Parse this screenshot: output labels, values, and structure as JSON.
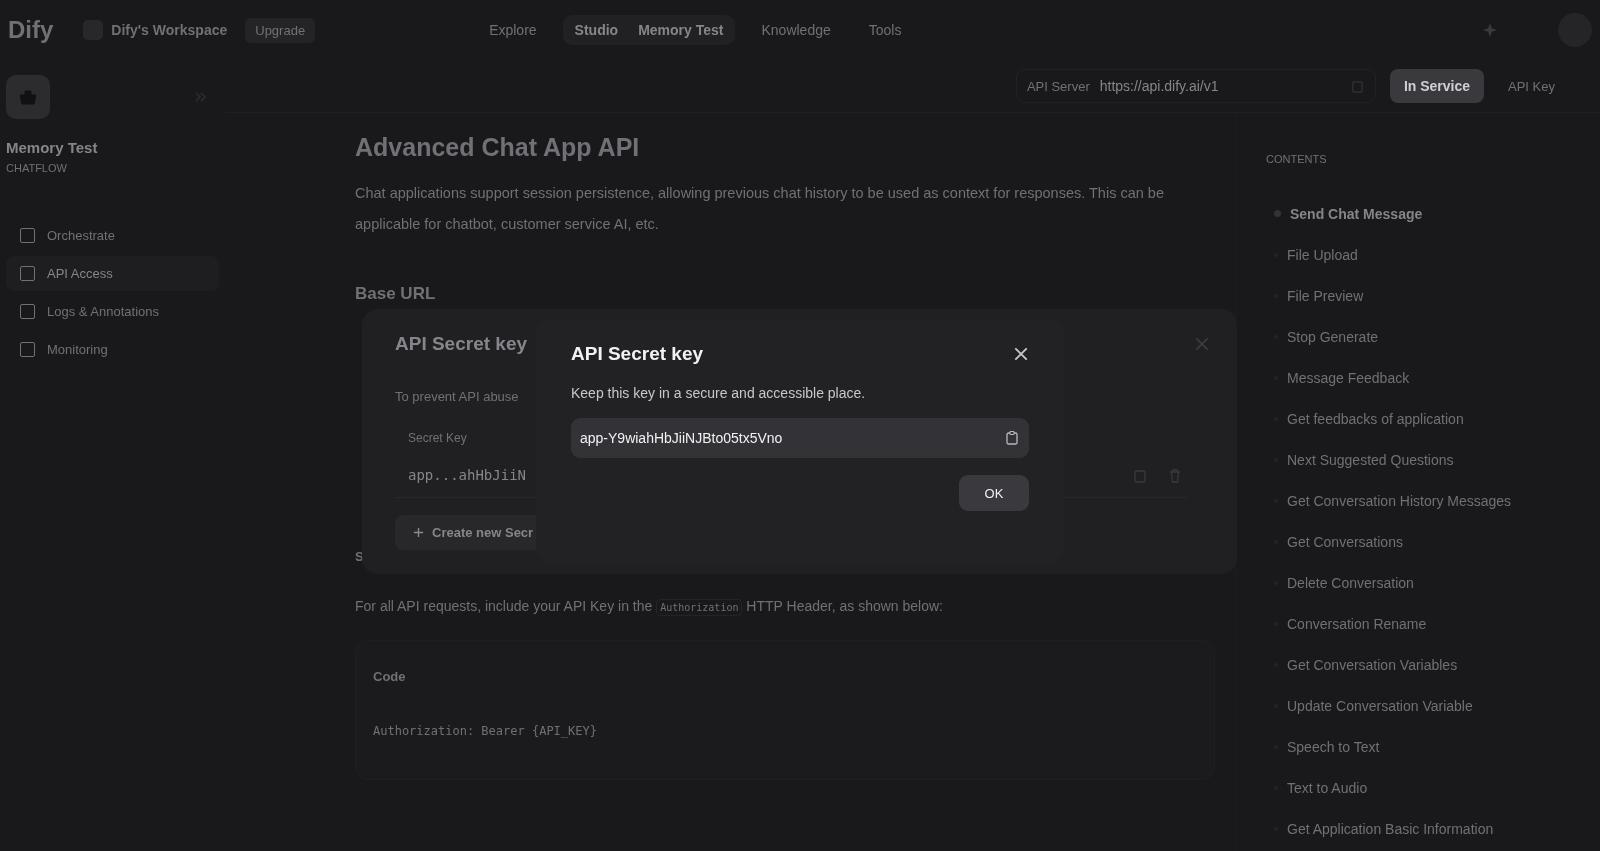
{
  "top_bar": {
    "logo": "Dify",
    "workspace": "Dify's Workspace",
    "upgrade": "Upgrade",
    "app_name": "Memory Test",
    "nav": [
      {
        "label": "Explore",
        "selected": false
      },
      {
        "label": "Studio",
        "selected": true
      },
      {
        "label": "Knowledge",
        "selected": false
      },
      {
        "label": "Tools",
        "selected": false
      }
    ]
  },
  "sidebar": {
    "app_name": "Memory Test",
    "app_type": "CHATFLOW",
    "items": [
      {
        "label": "Orchestrate",
        "selected": false
      },
      {
        "label": "API Access",
        "selected": true
      },
      {
        "label": "Logs & Annotations",
        "selected": false
      },
      {
        "label": "Monitoring",
        "selected": false
      }
    ]
  },
  "api_bar": {
    "label": "API Server",
    "url": "https://api.dify.ai/v1",
    "status": "In Service",
    "key_button": "API Key"
  },
  "doc": {
    "title": "Advanced Chat App API",
    "description": "Chat applications support session persistence, allowing previous chat history to be used as context for responses. This can be applicable for chatbot, customer service AI, etc.",
    "base_url_heading": "Base URL",
    "cut_letter": "S",
    "auth_before": "For all API requests, include your API Key in the",
    "auth_code": "Authorization",
    "auth_after": "HTTP Header, as shown below:"
  },
  "code_block": {
    "title": "Code",
    "code": "Authorization: Bearer {API_KEY}"
  },
  "contents": {
    "title": "CONTENTS",
    "items": [
      {
        "label": "Send Chat Message",
        "selected": true
      },
      {
        "label": "File Upload",
        "selected": false
      },
      {
        "label": "File Preview",
        "selected": false
      },
      {
        "label": "Stop Generate",
        "selected": false
      },
      {
        "label": "Message Feedback",
        "selected": false
      },
      {
        "label": "Get feedbacks of application",
        "selected": false
      },
      {
        "label": "Next Suggested Questions",
        "selected": false
      },
      {
        "label": "Get Conversation History Messages",
        "selected": false
      },
      {
        "label": "Get Conversations",
        "selected": false
      },
      {
        "label": "Delete Conversation",
        "selected": false
      },
      {
        "label": "Conversation Rename",
        "selected": false
      },
      {
        "label": "Get Conversation Variables",
        "selected": false
      },
      {
        "label": "Update Conversation Variable",
        "selected": false
      },
      {
        "label": "Speech to Text",
        "selected": false
      },
      {
        "label": "Text to Audio",
        "selected": false
      },
      {
        "label": "Get Application Basic Information",
        "selected": false
      }
    ]
  },
  "key_list_dialog": {
    "title": "API Secret key",
    "description": "To prevent API abuse",
    "column": "Secret Key",
    "key": "app...ahHbJiiN",
    "create_button": "Create new Secr"
  },
  "secret_dialog": {
    "title": "API Secret key",
    "description": "Keep this key in a secure and accessible place.",
    "key": "app-Y9wiahHbJiiNJBto05tx5Vno",
    "ok": "OK"
  }
}
